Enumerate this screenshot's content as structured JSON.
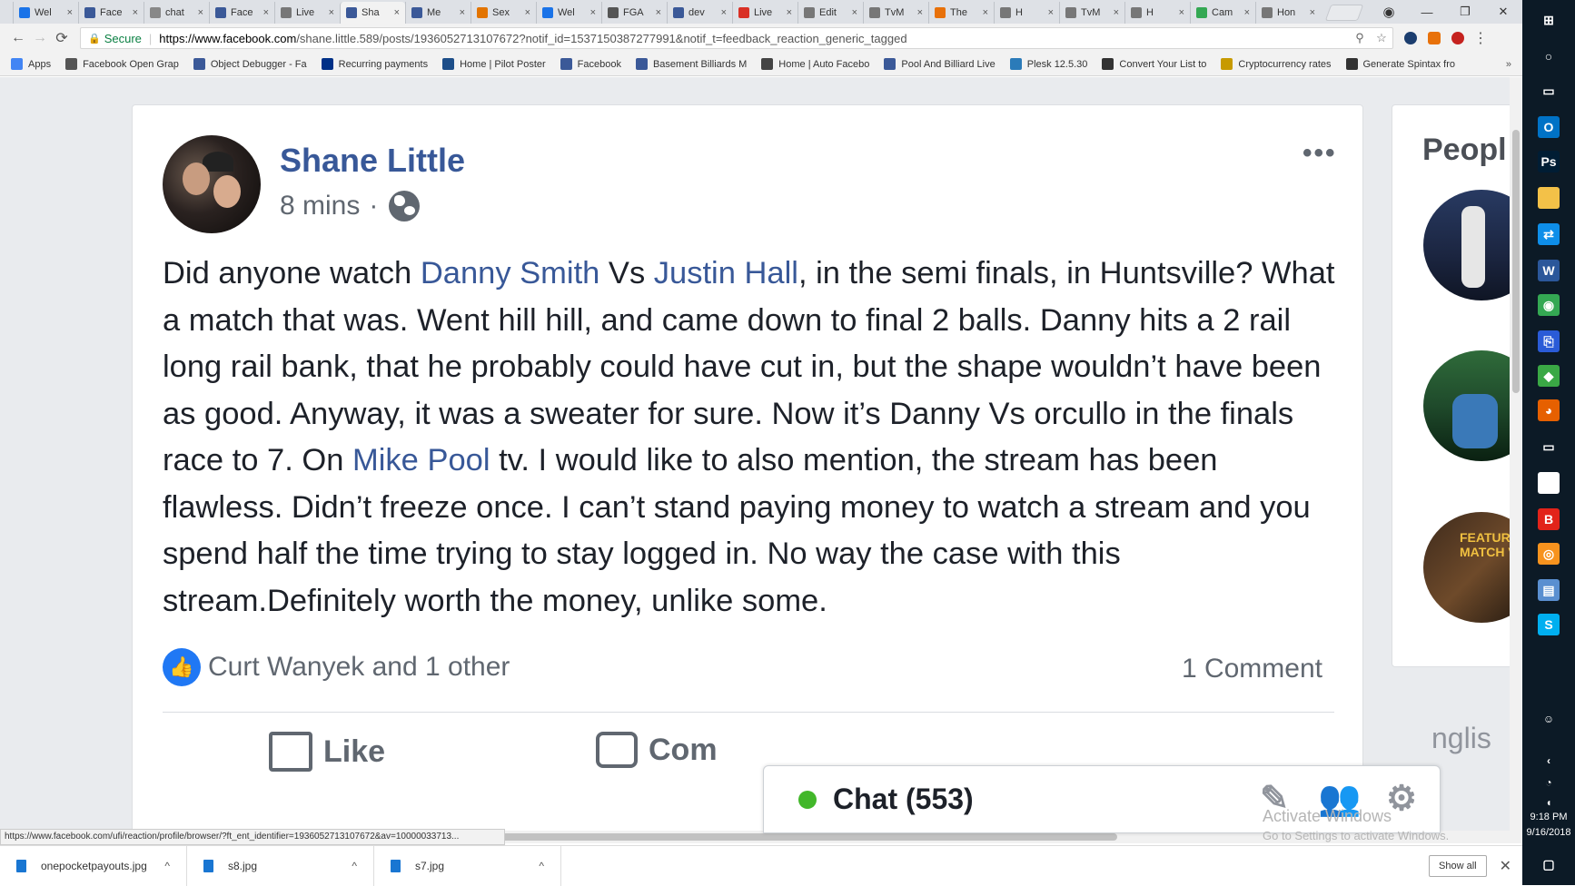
{
  "browser": {
    "tabs": [
      {
        "label": "Wel",
        "icon": "#1a73e8",
        "active": false
      },
      {
        "label": "Face",
        "icon": "#3b5998",
        "active": false
      },
      {
        "label": "chat",
        "icon": "#888888",
        "active": false
      },
      {
        "label": "Face",
        "icon": "#3b5998",
        "active": false
      },
      {
        "label": "Live",
        "icon": "#777777",
        "active": false
      },
      {
        "label": "Sha",
        "icon": "#3b5998",
        "active": true
      },
      {
        "label": "Me",
        "icon": "#3b5998",
        "active": false
      },
      {
        "label": "Sex",
        "icon": "#e37400",
        "active": false
      },
      {
        "label": "Wel",
        "icon": "#1a73e8",
        "active": false
      },
      {
        "label": "FGA",
        "icon": "#555555",
        "active": false
      },
      {
        "label": "dev",
        "icon": "#3b5998",
        "active": false
      },
      {
        "label": "Live",
        "icon": "#d93025",
        "active": false
      },
      {
        "label": "Edit",
        "icon": "#777777",
        "active": false
      },
      {
        "label": "TvM",
        "icon": "#777777",
        "active": false
      },
      {
        "label": "The",
        "icon": "#e8710a",
        "active": false
      },
      {
        "label": "H",
        "icon": "#777777",
        "active": false
      },
      {
        "label": "TvM",
        "icon": "#777777",
        "active": false
      },
      {
        "label": "H",
        "icon": "#777777",
        "active": false
      },
      {
        "label": "Cam",
        "icon": "#34a853",
        "active": false
      },
      {
        "label": "Hon",
        "icon": "#777777",
        "active": false
      }
    ],
    "tab_close": "×",
    "window_controls": {
      "minimize": "—",
      "restore": "❐",
      "close": "✕"
    },
    "nav": {
      "back": "←",
      "forward": "→",
      "reload": "⟳"
    },
    "address": {
      "secure_label": "Secure",
      "url_host": "https://www.facebook.com",
      "url_path": "/shane.little.589/posts/1936052713107672?notif_id=1537150387277991&notif_t=feedback_reaction_generic_tagged"
    },
    "bookmarks": [
      {
        "label": "Apps",
        "color": "#4285f4"
      },
      {
        "label": "Facebook Open Grap",
        "color": "#555555"
      },
      {
        "label": "Object Debugger - Fa",
        "color": "#3b5998"
      },
      {
        "label": "Recurring payments",
        "color": "#003087"
      },
      {
        "label": "Home | Pilot Poster",
        "color": "#1d4e89"
      },
      {
        "label": "Facebook",
        "color": "#3b5998"
      },
      {
        "label": "Basement Billiards M",
        "color": "#3b5998"
      },
      {
        "label": "Home | Auto Facebo",
        "color": "#444444"
      },
      {
        "label": "Pool And Billiard Live",
        "color": "#3b5998"
      },
      {
        "label": "Plesk 12.5.30",
        "color": "#2b7bb9"
      },
      {
        "label": "Convert Your List to",
        "color": "#333333"
      },
      {
        "label": "Cryptocurrency rates",
        "color": "#c79a00"
      },
      {
        "label": "Generate Spintax fro",
        "color": "#333333"
      }
    ],
    "bookmarks_more": "»"
  },
  "post": {
    "author": "Shane Little",
    "time": "8 mins",
    "meta_sep": "·",
    "more": "•••",
    "body_parts": [
      {
        "text": "Did anyone watch ",
        "link": false
      },
      {
        "text": "Danny Smith",
        "link": true
      },
      {
        "text": " Vs ",
        "link": false
      },
      {
        "text": "Justin Hall",
        "link": true
      },
      {
        "text": ", in the semi finals, in Huntsville? What a match that was. Went hill hill, and came down to final 2 balls. Danny hits a 2 rail long rail bank, that he probably could have cut in, but the shape wouldn’t have been as good. Anyway, it was a sweater for sure. Now it’s Danny Vs orcullo in the finals race to 7. On ",
        "link": false
      },
      {
        "text": "Mike Pool",
        "link": true
      },
      {
        "text": " tv. I would like to also mention, the stream has been flawless. Didn’t freeze once. I can’t stand paying money to watch a stream and you spend half the time trying to stay logged in. No way the case with this stream.Definitely worth the money, unlike some.",
        "link": false
      }
    ],
    "reactions": "Curt Wanyek and 1 other",
    "comments": "1 Comment",
    "actions": {
      "like": "Like",
      "comment": "Com"
    }
  },
  "sidebar": {
    "title": "Peopl",
    "card3_text": "FEATURE MATCH VS",
    "language": "nglis"
  },
  "chat": {
    "label": "Chat (553)",
    "status_color": "#42b72a"
  },
  "watermark": {
    "title": "Activate Windows",
    "subtitle": "Go to Settings to activate Windows."
  },
  "status_url": "https://www.facebook.com/ufi/reaction/profile/browser/?ft_ent_identifier=1936052713107672&av=10000033713...",
  "downloads": [
    {
      "name": "onepocketpayouts.jpg"
    },
    {
      "name": "s8.jpg"
    },
    {
      "name": "s7.jpg"
    }
  ],
  "downloads_show_all": "Show all",
  "taskbar": {
    "time": "9:18 PM",
    "date": "9/16/2018",
    "icons": [
      {
        "name": "windows",
        "color": "#0c1a26",
        "glyph": "⊞"
      },
      {
        "name": "cortana",
        "color": "#0c1a26",
        "glyph": "○"
      },
      {
        "name": "task-view",
        "color": "#0c1a26",
        "glyph": "▭"
      },
      {
        "name": "outlook",
        "color": "#0072c6",
        "glyph": "O"
      },
      {
        "name": "photoshop",
        "color": "#001d34",
        "glyph": "Ps"
      },
      {
        "name": "file-explorer",
        "color": "#f3c148",
        "glyph": ""
      },
      {
        "name": "teamviewer",
        "color": "#0e8ee9",
        "glyph": "⇄"
      },
      {
        "name": "word",
        "color": "#2b579a",
        "glyph": "W"
      },
      {
        "name": "chrome",
        "color": "#34a853",
        "glyph": "◉"
      },
      {
        "name": "remote",
        "color": "#2a5bd7",
        "glyph": "⎘"
      },
      {
        "name": "green-app",
        "color": "#3aa845",
        "glyph": "◆"
      },
      {
        "name": "firefox",
        "color": "#e66000",
        "glyph": "◕"
      },
      {
        "name": "display",
        "color": "#0c1a26",
        "glyph": "▭"
      },
      {
        "name": "notes",
        "color": "#ffffff",
        "glyph": ""
      },
      {
        "name": "b-app",
        "color": "#e2231a",
        "glyph": "B"
      },
      {
        "name": "orange-app",
        "color": "#f7931e",
        "glyph": "◎"
      },
      {
        "name": "files",
        "color": "#5a8fd0",
        "glyph": "▤"
      },
      {
        "name": "skype",
        "color": "#00aff0",
        "glyph": "S"
      }
    ]
  }
}
